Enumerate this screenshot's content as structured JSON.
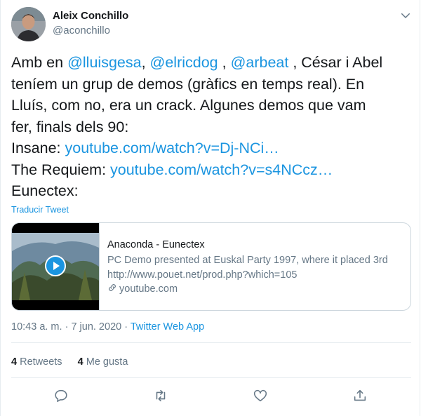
{
  "author": {
    "name": "Aleix Conchillo",
    "handle": "@aconchillo"
  },
  "tweet": {
    "lines": [
      [
        {
          "text": "Amb en ",
          "link": false
        },
        {
          "text": "@lluisgesa",
          "link": true
        },
        {
          "text": ", ",
          "link": false
        },
        {
          "text": "@elricdog",
          "link": true
        },
        {
          "text": " , ",
          "link": false
        },
        {
          "text": "@arbeat",
          "link": true
        },
        {
          "text": " , César i Abel",
          "link": false
        }
      ],
      [
        {
          "text": "teníem un grup de demos (gràfics en temps real). En",
          "link": false
        }
      ],
      [
        {
          "text": "Lluís, com no, era un crack. Algunes demos que vam",
          "link": false
        }
      ],
      [
        {
          "text": "fer, finals dels 90:",
          "link": false
        }
      ],
      [
        {
          "text": "Insane: ",
          "link": false
        },
        {
          "text": "youtube.com/watch?v=Dj-NCi…",
          "link": true
        }
      ],
      [
        {
          "text": "The Requiem: ",
          "link": false
        },
        {
          "text": "youtube.com/watch?v=s4NCcz…",
          "link": true
        }
      ],
      [
        {
          "text": "Eunectex:",
          "link": false
        }
      ]
    ],
    "translate_label": "Traducir Tweet"
  },
  "card": {
    "title": "Anaconda - Eunectex",
    "description": "PC Demo presented at Euskal Party 1997, where it placed 3rd http://www.pouet.net/prod.php?which=105",
    "domain": "youtube.com"
  },
  "meta": {
    "time": "10:43 a. m.",
    "separator": " · ",
    "date": "7 jun. 2020",
    "app": "Twitter Web App"
  },
  "stats": {
    "retweets_count": "4",
    "retweets_label": "Retweets",
    "likes_count": "4",
    "likes_label": "Me gusta"
  },
  "icons": {
    "caret": "chevron-down-icon",
    "reply": "reply-icon",
    "retweet": "retweet-icon",
    "like": "heart-icon",
    "share": "share-icon"
  },
  "colors": {
    "link": "#1b95e0",
    "secondary_text": "#657786",
    "border": "#e6ecf0"
  }
}
